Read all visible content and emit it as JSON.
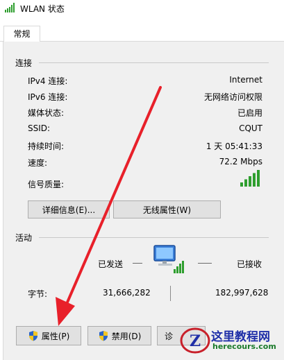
{
  "window": {
    "title": "WLAN 状态"
  },
  "tabs": [
    {
      "label": "常规"
    }
  ],
  "connection": {
    "header": "连接",
    "rows": [
      {
        "label": "IPv4 连接:",
        "value": "Internet"
      },
      {
        "label": "IPv6 连接:",
        "value": "无网络访问权限"
      },
      {
        "label": "媒体状态:",
        "value": "已启用"
      },
      {
        "label": "SSID:",
        "value": "CQUT"
      },
      {
        "label": "持续时间:",
        "value": "1 天 05:41:33"
      },
      {
        "label": "速度:",
        "value": "72.2 Mbps"
      }
    ],
    "signal_label": "信号质量:",
    "signal_bars": 5,
    "signal_bars_max": 5,
    "details_button": "详细信息(E)...",
    "wireless_button": "无线属性(W)"
  },
  "activity": {
    "header": "活动",
    "sent_label": "已发送",
    "received_label": "已接收",
    "bytes_label": "字节:",
    "bytes_sent": "31,666,282",
    "bytes_received": "182,997,628"
  },
  "bottom_buttons": {
    "properties": "属性(P)",
    "disable": "禁用(D)",
    "diagnose": "诊"
  },
  "watermark": {
    "title": "这里教程网",
    "url": "herecours.com",
    "logo_letter": "Z"
  },
  "colors": {
    "accent_arrow": "#e8202a",
    "signal_green": "#2e9e2e",
    "panel_bg": "#f0f0f0",
    "button_bg": "#e1e1e1"
  },
  "icons": {
    "title": "wifi-signal-icon",
    "shield": "uac-shield-icon",
    "network": "network-computer-icon"
  }
}
